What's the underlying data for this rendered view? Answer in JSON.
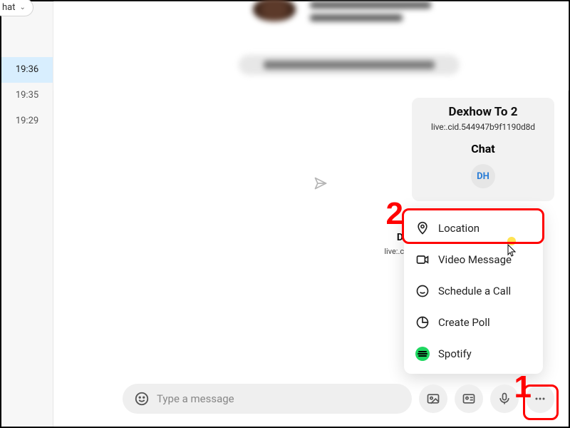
{
  "sidebar": {
    "filter_label": "hat",
    "times": [
      "19:36",
      "19:35",
      "19:29"
    ],
    "active_index": 0
  },
  "contact": {
    "name": "Dexhow To 2",
    "id": "live:.cid.544947b9f1190d8d",
    "section": "Chat",
    "avatar_initials": "DH",
    "second_name_initial": "D",
    "second_id_prefix": "live:.cid"
  },
  "menu": {
    "items": [
      {
        "label": "Location",
        "icon": "pin"
      },
      {
        "label": "Video Message",
        "icon": "video"
      },
      {
        "label": "Schedule a Call",
        "icon": "calendar-phone"
      },
      {
        "label": "Create Poll",
        "icon": "pie"
      },
      {
        "label": "Spotify",
        "icon": "spotify"
      }
    ]
  },
  "composer": {
    "placeholder": "Type a message"
  },
  "annotations": {
    "step1": "1",
    "step2": "2"
  },
  "colors": {
    "annotation": "#ff0000",
    "skype_accent": "#2a7dd6",
    "spotify": "#1ed760",
    "sidebar_active": "#d8eefe"
  }
}
